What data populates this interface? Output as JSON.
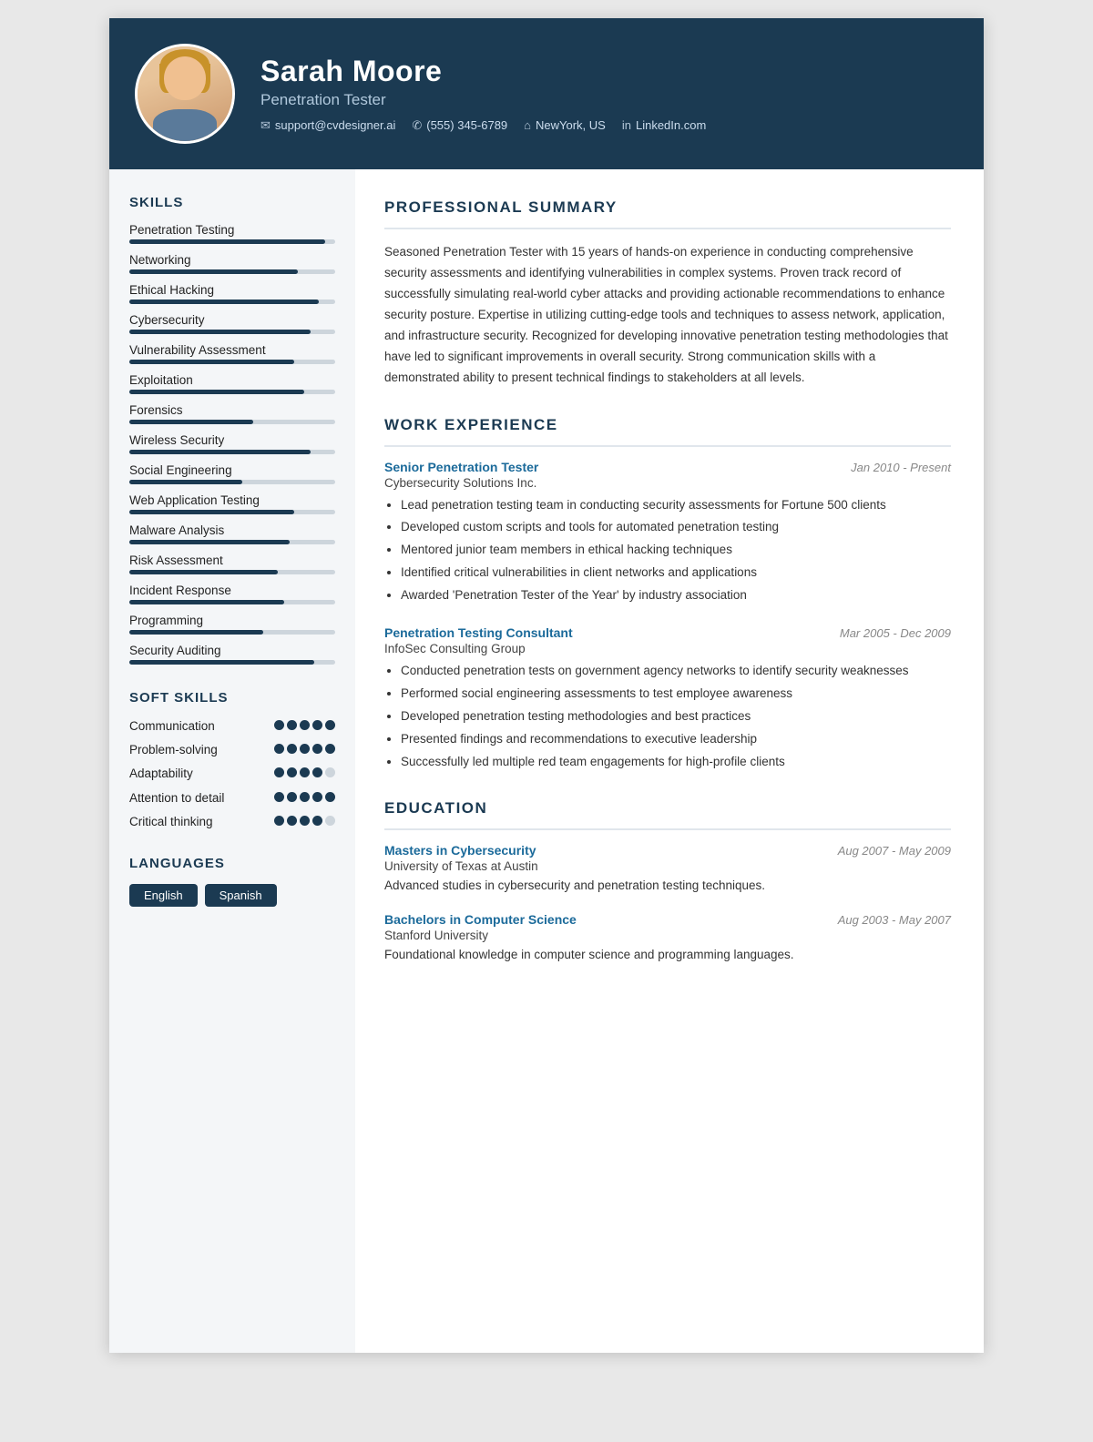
{
  "header": {
    "name": "Sarah Moore",
    "title": "Penetration Tester",
    "contacts": [
      {
        "icon": "✉",
        "text": "support@cvdesigner.ai"
      },
      {
        "icon": "✆",
        "text": "(555) 345-6789"
      },
      {
        "icon": "⌂",
        "text": "NewYork, US"
      },
      {
        "icon": "in",
        "text": "LinkedIn.com"
      }
    ]
  },
  "sidebar": {
    "skills_title": "SKILLS",
    "skills": [
      {
        "name": "Penetration Testing",
        "pct": 95
      },
      {
        "name": "Networking",
        "pct": 82
      },
      {
        "name": "Ethical Hacking",
        "pct": 92
      },
      {
        "name": "Cybersecurity",
        "pct": 88
      },
      {
        "name": "Vulnerability Assessment",
        "pct": 80
      },
      {
        "name": "Exploitation",
        "pct": 85
      },
      {
        "name": "Forensics",
        "pct": 60
      },
      {
        "name": "Wireless Security",
        "pct": 88
      },
      {
        "name": "Social Engineering",
        "pct": 55
      },
      {
        "name": "Web Application Testing",
        "pct": 80
      },
      {
        "name": "Malware Analysis",
        "pct": 78
      },
      {
        "name": "Risk Assessment",
        "pct": 72
      },
      {
        "name": "Incident Response",
        "pct": 75
      },
      {
        "name": "Programming",
        "pct": 65
      },
      {
        "name": "Security Auditing",
        "pct": 90
      }
    ],
    "soft_skills_title": "SOFT SKILLS",
    "soft_skills": [
      {
        "name": "Communication",
        "filled": 5
      },
      {
        "name": "Problem-solving",
        "filled": 5
      },
      {
        "name": "Adaptability",
        "filled": 4
      },
      {
        "name": "Attention to detail",
        "filled": 5
      },
      {
        "name": "Critical thinking",
        "filled": 4
      }
    ],
    "languages_title": "LANGUAGES",
    "languages": [
      "English",
      "Spanish"
    ]
  },
  "main": {
    "summary_title": "PROFESSIONAL SUMMARY",
    "summary_text": "Seasoned Penetration Tester with 15 years of hands-on experience in conducting comprehensive security assessments and identifying vulnerabilities in complex systems. Proven track record of successfully simulating real-world cyber attacks and providing actionable recommendations to enhance security posture. Expertise in utilizing cutting-edge tools and techniques to assess network, application, and infrastructure security. Recognized for developing innovative penetration testing methodologies that have led to significant improvements in overall security. Strong communication skills with a demonstrated ability to present technical findings to stakeholders at all levels.",
    "work_title": "WORK EXPERIENCE",
    "jobs": [
      {
        "title": "Senior Penetration Tester",
        "date": "Jan 2010 - Present",
        "company": "Cybersecurity Solutions Inc.",
        "bullets": [
          "Lead penetration testing team in conducting security assessments for Fortune 500 clients",
          "Developed custom scripts and tools for automated penetration testing",
          "Mentored junior team members in ethical hacking techniques",
          "Identified critical vulnerabilities in client networks and applications",
          "Awarded 'Penetration Tester of the Year' by industry association"
        ]
      },
      {
        "title": "Penetration Testing Consultant",
        "date": "Mar 2005 - Dec 2009",
        "company": "InfoSec Consulting Group",
        "bullets": [
          "Conducted penetration tests on government agency networks to identify security weaknesses",
          "Performed social engineering assessments to test employee awareness",
          "Developed penetration testing methodologies and best practices",
          "Presented findings and recommendations to executive leadership",
          "Successfully led multiple red team engagements for high-profile clients"
        ]
      }
    ],
    "education_title": "EDUCATION",
    "education": [
      {
        "degree": "Masters in Cybersecurity",
        "date": "Aug 2007 - May 2009",
        "school": "University of Texas at Austin",
        "desc": "Advanced studies in cybersecurity and penetration testing techniques."
      },
      {
        "degree": "Bachelors in Computer Science",
        "date": "Aug 2003 - May 2007",
        "school": "Stanford University",
        "desc": "Foundational knowledge in computer science and programming languages."
      }
    ]
  }
}
